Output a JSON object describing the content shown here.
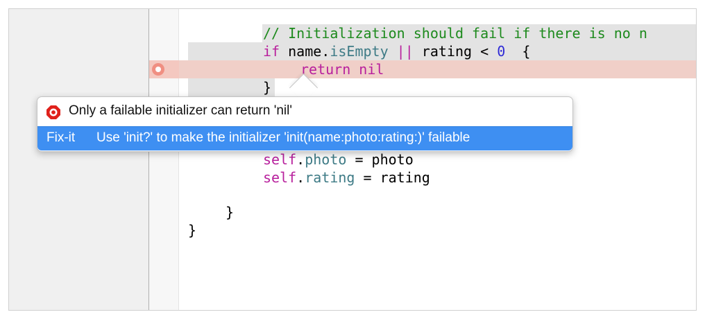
{
  "code": {
    "comment": "// Initialization should fail if there is no n",
    "if_kw": "if",
    "if_var": " name.",
    "if_prop": "isEmpty",
    "if_or": " ||",
    "if_mid": " rating < ",
    "if_num": "0",
    "if_brace": "  {",
    "return_kw": "return",
    "nil_kw": "nil",
    "close_if": "}",
    "self_photo_kw": "self",
    "self_photo_dot": ".",
    "self_photo_prop": "photo",
    "self_photo_rest": " = photo",
    "self_rating_kw": "self",
    "self_rating_dot": ".",
    "self_rating_prop": "rating",
    "self_rating_rest": " = rating",
    "close_init": "}",
    "close_class": "}"
  },
  "popover": {
    "error_icon": "stop-sign-icon",
    "error_message": "Only a failable initializer can return 'nil'",
    "fixit_label": "Fix-it",
    "fixit_text": "Use 'init?' to make the initializer 'init(name:photo:rating:)' failable"
  },
  "colors": {
    "comment": "#1d8a1d",
    "keyword": "#b8209d",
    "property": "#3e7b86",
    "number": "#2e2bd6",
    "error_line": "#f0cfc8",
    "fixit_highlight": "#3e8ff2",
    "error_icon": "#e0211b"
  }
}
